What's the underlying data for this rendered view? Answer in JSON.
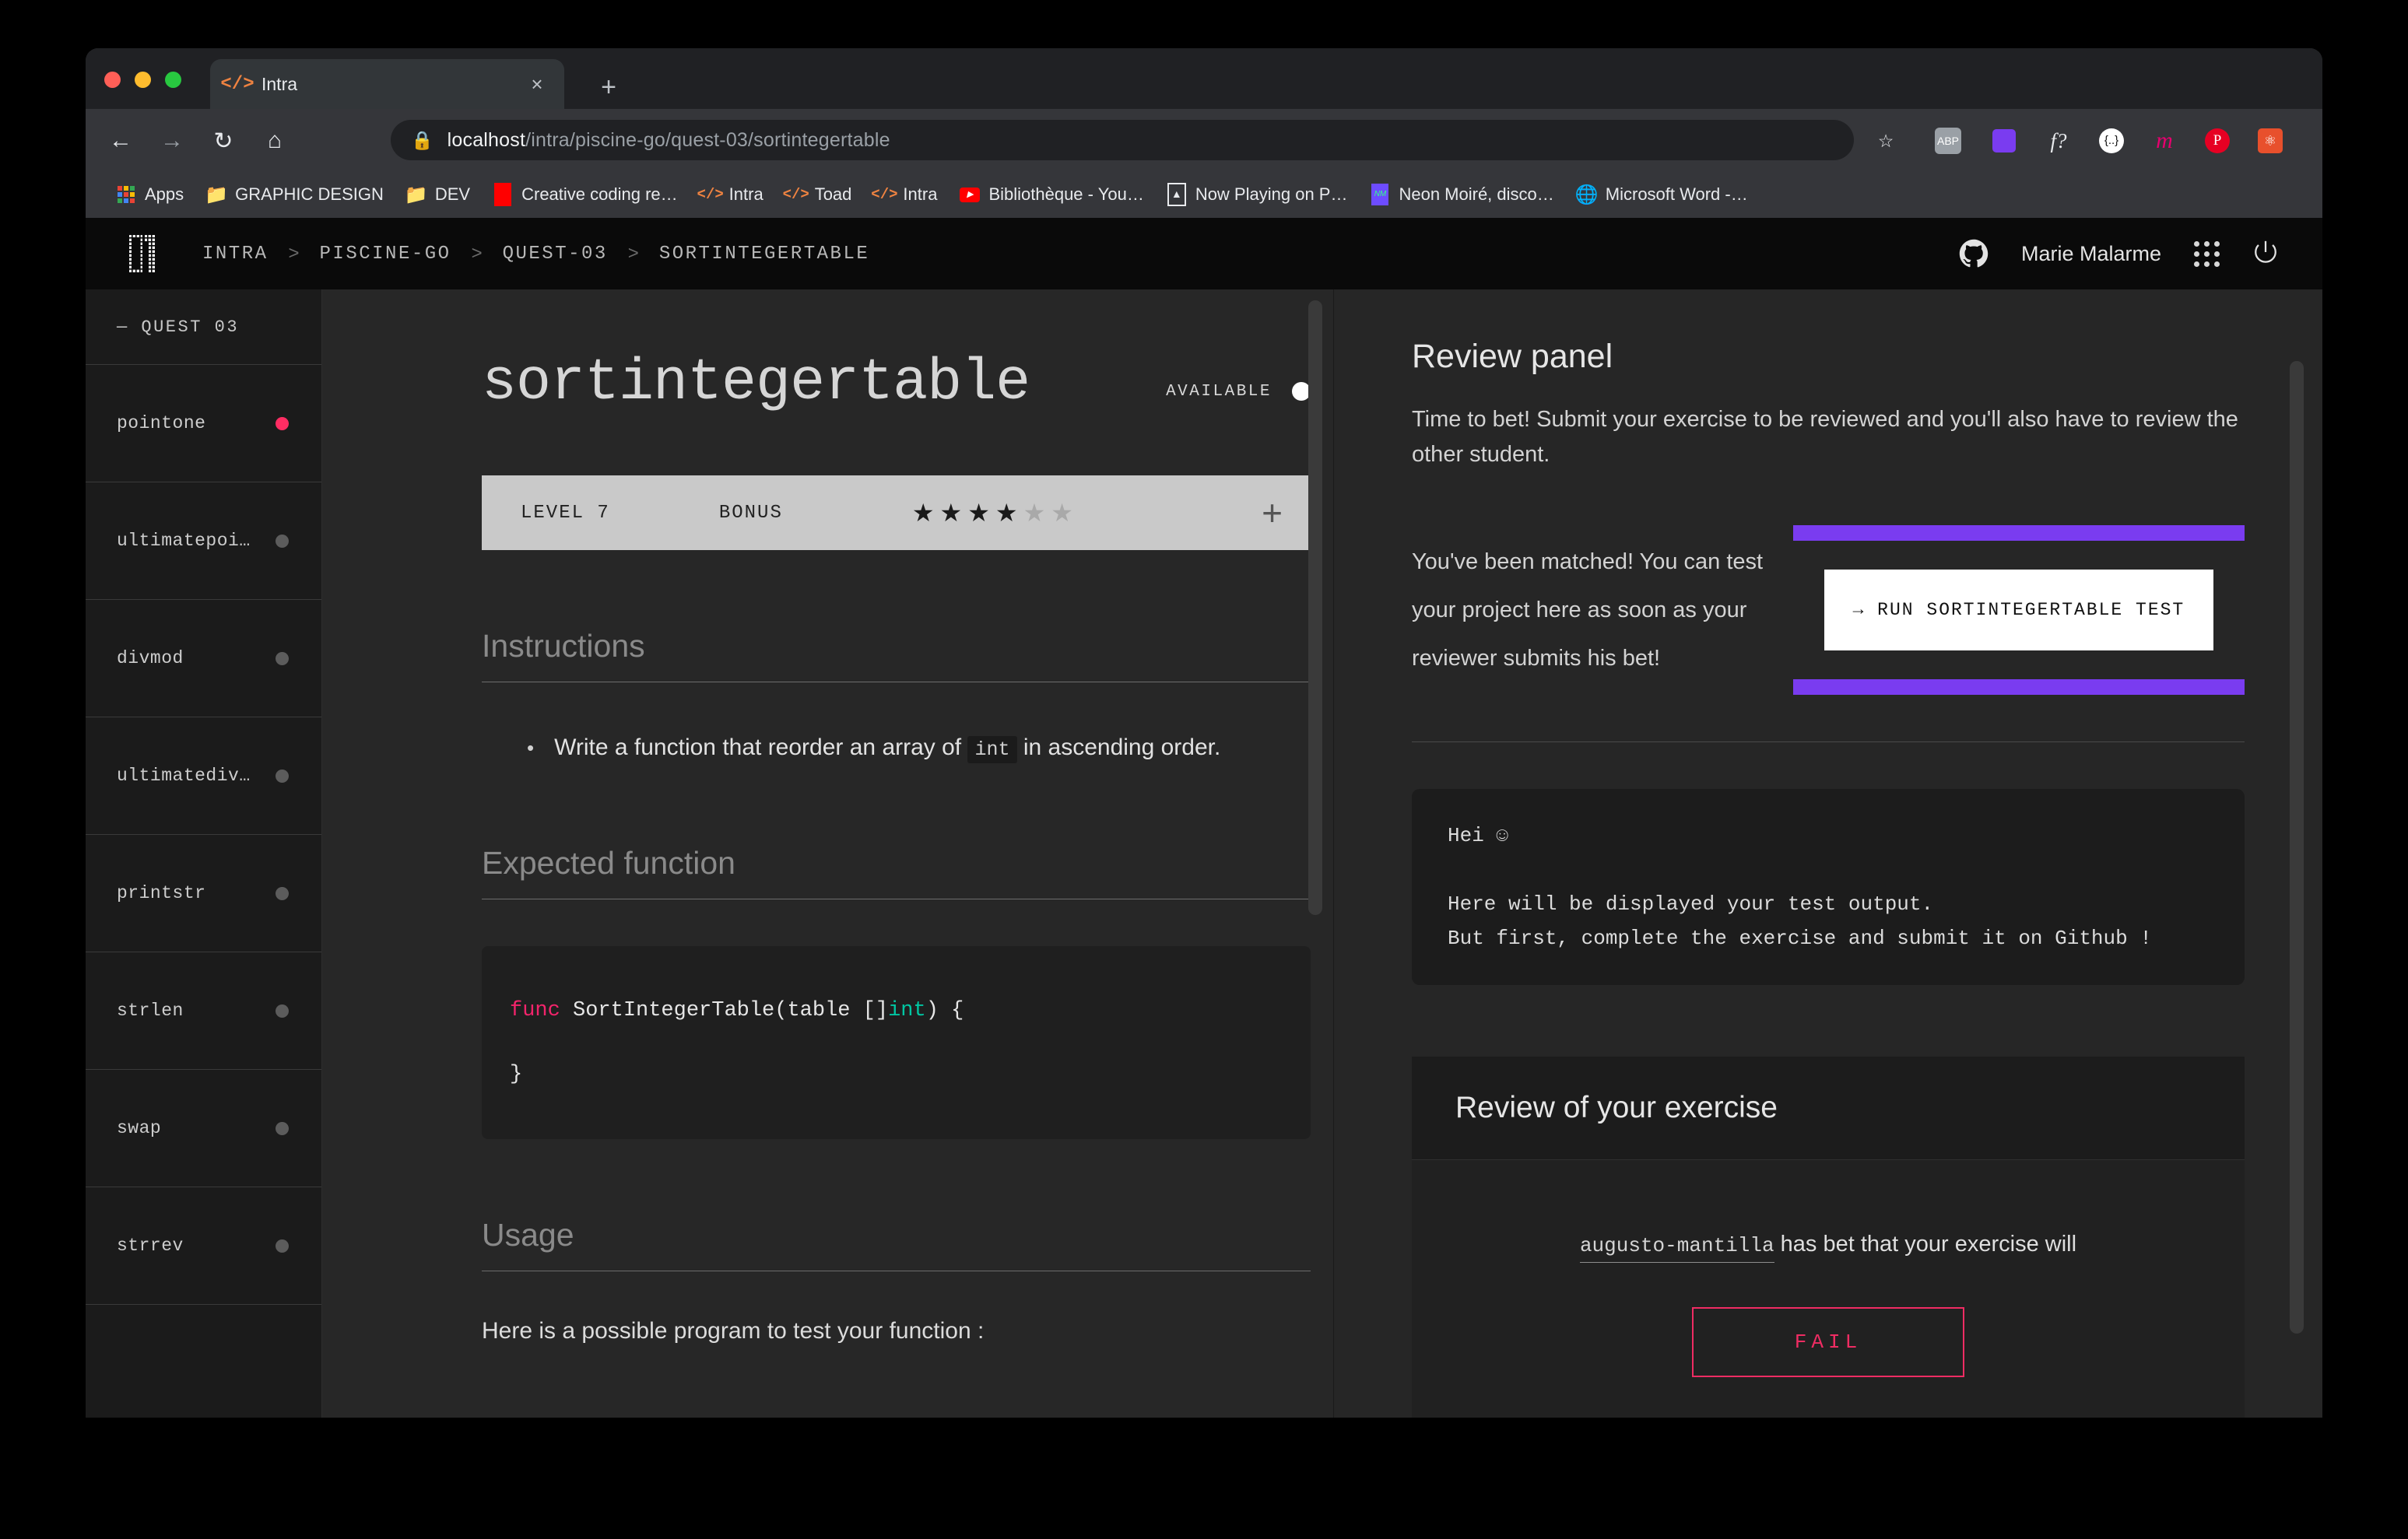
{
  "browser": {
    "tab": {
      "title": "Intra",
      "favicon": "code-icon",
      "close": "×"
    },
    "new_tab": "+",
    "nav": {
      "back": "←",
      "forward": "→",
      "reload": "↻",
      "home": "⌂"
    },
    "url": {
      "lock": "🔒",
      "host": "localhost",
      "path": "/intra/piscine-go/quest-03/sortintegertable"
    },
    "toolbar_icons": [
      "star-icon",
      "adblock-icon",
      "colorpick-icon",
      "fontface-icon",
      "json-icon",
      "mailchimp-icon",
      "pinterest-icon",
      "react-icon",
      "avatar-icon",
      "menu-icon"
    ],
    "bookmarks": [
      {
        "label": "Apps",
        "icon": "apps-grid-icon"
      },
      {
        "label": "GRAPHIC DESIGN",
        "icon": "folder-icon"
      },
      {
        "label": "DEV",
        "icon": "folder-icon"
      },
      {
        "label": "Creative coding re…",
        "icon": "red-square-icon"
      },
      {
        "label": "Intra",
        "icon": "code-icon"
      },
      {
        "label": "Toad",
        "icon": "code-icon"
      },
      {
        "label": "Intra",
        "icon": "code-icon"
      },
      {
        "label": "Bibliothèque - You…",
        "icon": "youtube-icon"
      },
      {
        "label": "Now Playing on P…",
        "icon": "plex-icon"
      },
      {
        "label": "Neon Moiré, disco…",
        "icon": "neon-icon"
      },
      {
        "label": "Microsoft Word -…",
        "icon": "globe-icon"
      }
    ]
  },
  "appbar": {
    "logo": "01",
    "breadcrumbs": [
      "INTRA",
      "PISCINE-GO",
      "QUEST-03",
      "SORTINTEGERTABLE"
    ],
    "separator": ">",
    "github_icon": "github-icon",
    "username": "Marie Malarme",
    "grid_icon": "apps-grid-icon",
    "power_icon": "power-icon"
  },
  "sidebar": {
    "header": "— QUEST 03",
    "items": [
      {
        "label": "pointone",
        "status": "active"
      },
      {
        "label": "ultimatepoi…",
        "status": "inactive"
      },
      {
        "label": "divmod",
        "status": "inactive"
      },
      {
        "label": "ultimatediv…",
        "status": "inactive"
      },
      {
        "label": "printstr",
        "status": "inactive"
      },
      {
        "label": "strlen",
        "status": "inactive"
      },
      {
        "label": "swap",
        "status": "inactive"
      },
      {
        "label": "strrev",
        "status": "inactive"
      }
    ],
    "active_color": "#ff2d63",
    "inactive_color": "#5c5c5c"
  },
  "exercise": {
    "title": "sortintegertable",
    "availability_label": "AVAILABLE",
    "meta": {
      "level_label": "LEVEL 7",
      "bonus_label": "BONUS",
      "stars_filled": 4,
      "stars_total": 6,
      "add_icon": "+"
    },
    "instructions": {
      "heading": "Instructions",
      "bullet_prefix": "Write a function that reorder an array of ",
      "bullet_code": "int",
      "bullet_suffix": " in ascending order."
    },
    "expected_function": {
      "heading": "Expected function",
      "code_kw": "func",
      "code_name": " SortIntegerTable(table []",
      "code_type": "int",
      "code_tail": ") {",
      "code_close": "}"
    },
    "usage": {
      "heading": "Usage",
      "text": "Here is a possible program to test your function :"
    }
  },
  "review_panel": {
    "title": "Review panel",
    "intro": "Time to bet! Submit your exercise to be reviewed and you'll also have to review the other student.",
    "matched_text": "You've been matched! You can test your project here as soon as your reviewer submits his bet!",
    "run_button": "→  RUN SORTINTEGERTABLE TEST",
    "highlight_color": "#7a3cf0",
    "terminal": "Hei ☺\n\nHere will be displayed your test output.\nBut first, complete the exercise and submit it on Github !",
    "review_card": {
      "heading": "Review of your exercise",
      "bet_user": "augusto-mantilla",
      "bet_text": " has bet that your exercise will",
      "bet_result": "FAIL",
      "fail_color": "#ef2c63"
    }
  }
}
